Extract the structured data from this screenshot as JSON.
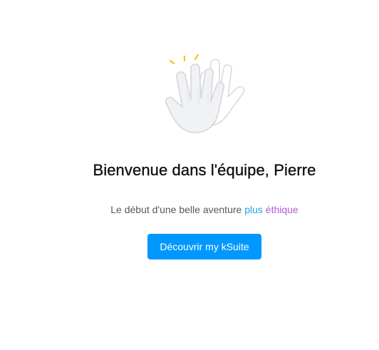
{
  "welcome": {
    "title": "Bienvenue dans l'équipe, Pierre",
    "subtitle_prefix": "Le début d'une belle aventure ",
    "subtitle_plus": "plus",
    "subtitle_space": " ",
    "subtitle_ethique": "éthique",
    "cta_label": "Découvrir my kSuite",
    "illustration_icon": "waving-hands-icon"
  },
  "colors": {
    "button": "#0098ff",
    "plus": "#1ea7e8",
    "ethique_gradient": [
      "#b25bd9",
      "#d9609f",
      "#ee7a58"
    ],
    "sparkle": "#f5c518"
  }
}
